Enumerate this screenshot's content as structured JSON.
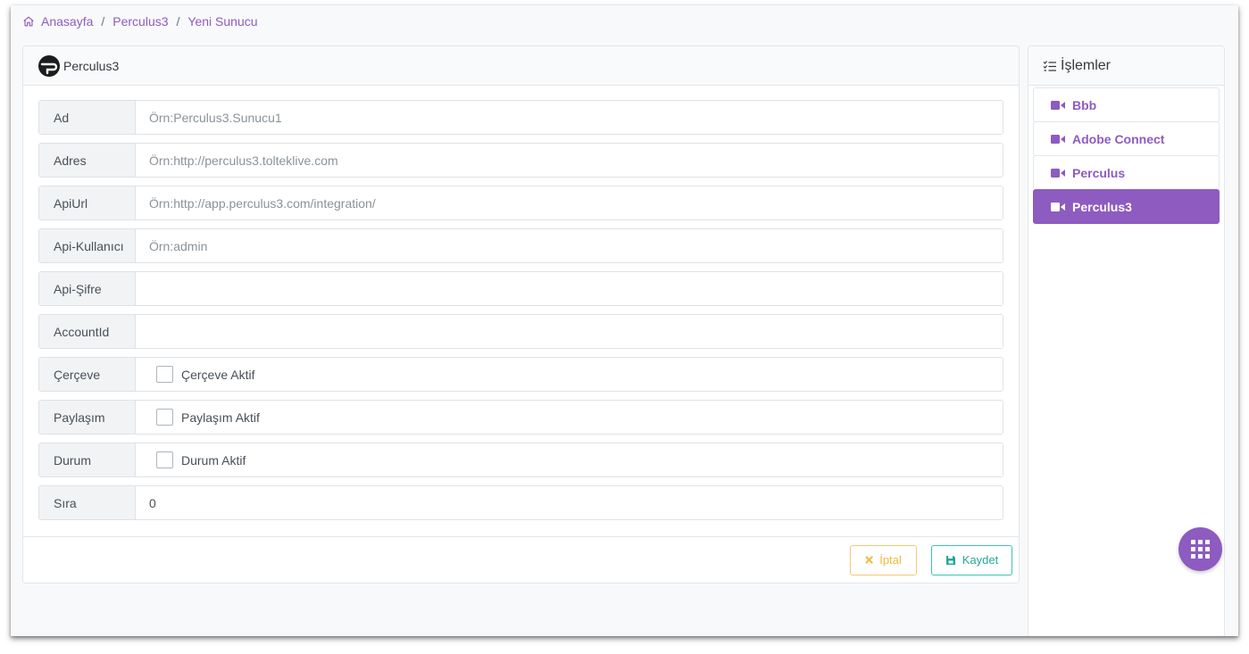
{
  "breadcrumb": {
    "items": [
      {
        "label": "Anasayfa"
      },
      {
        "label": "Perculus3"
      },
      {
        "label": "Yeni Sunucu"
      }
    ],
    "separator": "/"
  },
  "form": {
    "title": "Perculus3",
    "fields": [
      {
        "label": "Ad",
        "value": "",
        "placeholder": "Örn:Perculus3.Sunucu1"
      },
      {
        "label": "Adres",
        "value": "",
        "placeholder": "Örn:http://perculus3.tolteklive.com"
      },
      {
        "label": "ApiUrl",
        "value": "",
        "placeholder": "Örn:http://app.perculus3.com/integration/"
      },
      {
        "label": "Api-Kullanıcı",
        "value": "",
        "placeholder": "Örn:admin"
      },
      {
        "label": "Api-Şifre",
        "value": "",
        "placeholder": ""
      },
      {
        "label": "AccountId",
        "value": "",
        "placeholder": ""
      }
    ],
    "checkboxes": [
      {
        "label": "Çerçeve",
        "text": "Çerçeve Aktif",
        "checked": false
      },
      {
        "label": "Paylaşım",
        "text": "Paylaşım Aktif",
        "checked": false
      },
      {
        "label": "Durum",
        "text": "Durum Aktif",
        "checked": false
      }
    ],
    "order": {
      "label": "Sıra",
      "value": "0"
    },
    "cancel_label": "İptal",
    "save_label": "Kaydet"
  },
  "sidebar": {
    "title": "İşlemler",
    "items": [
      {
        "label": "Bbb",
        "active": false
      },
      {
        "label": "Adobe Connect",
        "active": false
      },
      {
        "label": "Perculus",
        "active": false
      },
      {
        "label": "Perculus3",
        "active": true
      }
    ]
  },
  "colors": {
    "accent": "#8e5bc1",
    "cancel": "#f5b63d",
    "save": "#24a894"
  },
  "icons": {
    "breadcrumb_home": "home-icon",
    "card_logo": "perculus-logo-icon",
    "sidebar_header": "list-check-icon",
    "sidebar_item": "video-icon",
    "cancel": "close-icon",
    "save": "floppy-disk-icon",
    "fab": "grid-menu-icon"
  }
}
